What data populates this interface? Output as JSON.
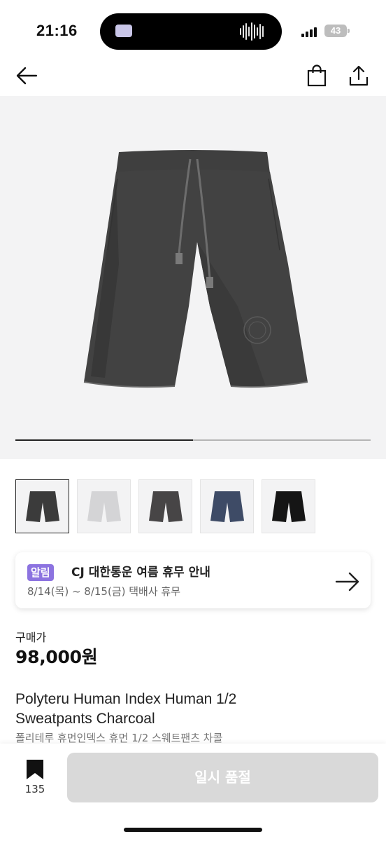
{
  "status": {
    "time": "21:16",
    "battery": "43"
  },
  "nav": {
    "back_icon": "arrow-left-icon",
    "cart_icon": "shopping-bag-icon",
    "share_icon": "share-icon"
  },
  "gallery": {
    "progress": 0.5,
    "active_thumb": 0
  },
  "thumbnails": [
    {
      "color": "#3b3b3b",
      "label": "charcoal"
    },
    {
      "color": "#d4d4d6",
      "label": "light-gray"
    },
    {
      "color": "#474546",
      "label": "dark-gray"
    },
    {
      "color": "#3e4b66",
      "label": "navy"
    },
    {
      "color": "#151515",
      "label": "black"
    }
  ],
  "notice": {
    "badge": "알림",
    "title": "CJ 대한통운 여름 휴무 안내",
    "subtitle": "8/14(목) ~ 8/15(금) 택배사 휴무"
  },
  "price": {
    "label": "구매가",
    "value": "98,000원"
  },
  "product": {
    "name_en": "Polyteru Human Index Human 1/2 Sweatpants Charcoal",
    "name_ko": "폴리테루 휴먼인덱스 휴먼 1/2 스웨트팬츠 차콜"
  },
  "bottom": {
    "bookmark_count": "135",
    "cta_label": "일시 품절"
  },
  "colors": {
    "accent": "#8c73e0",
    "cta_disabled": "#d9d9d9"
  }
}
